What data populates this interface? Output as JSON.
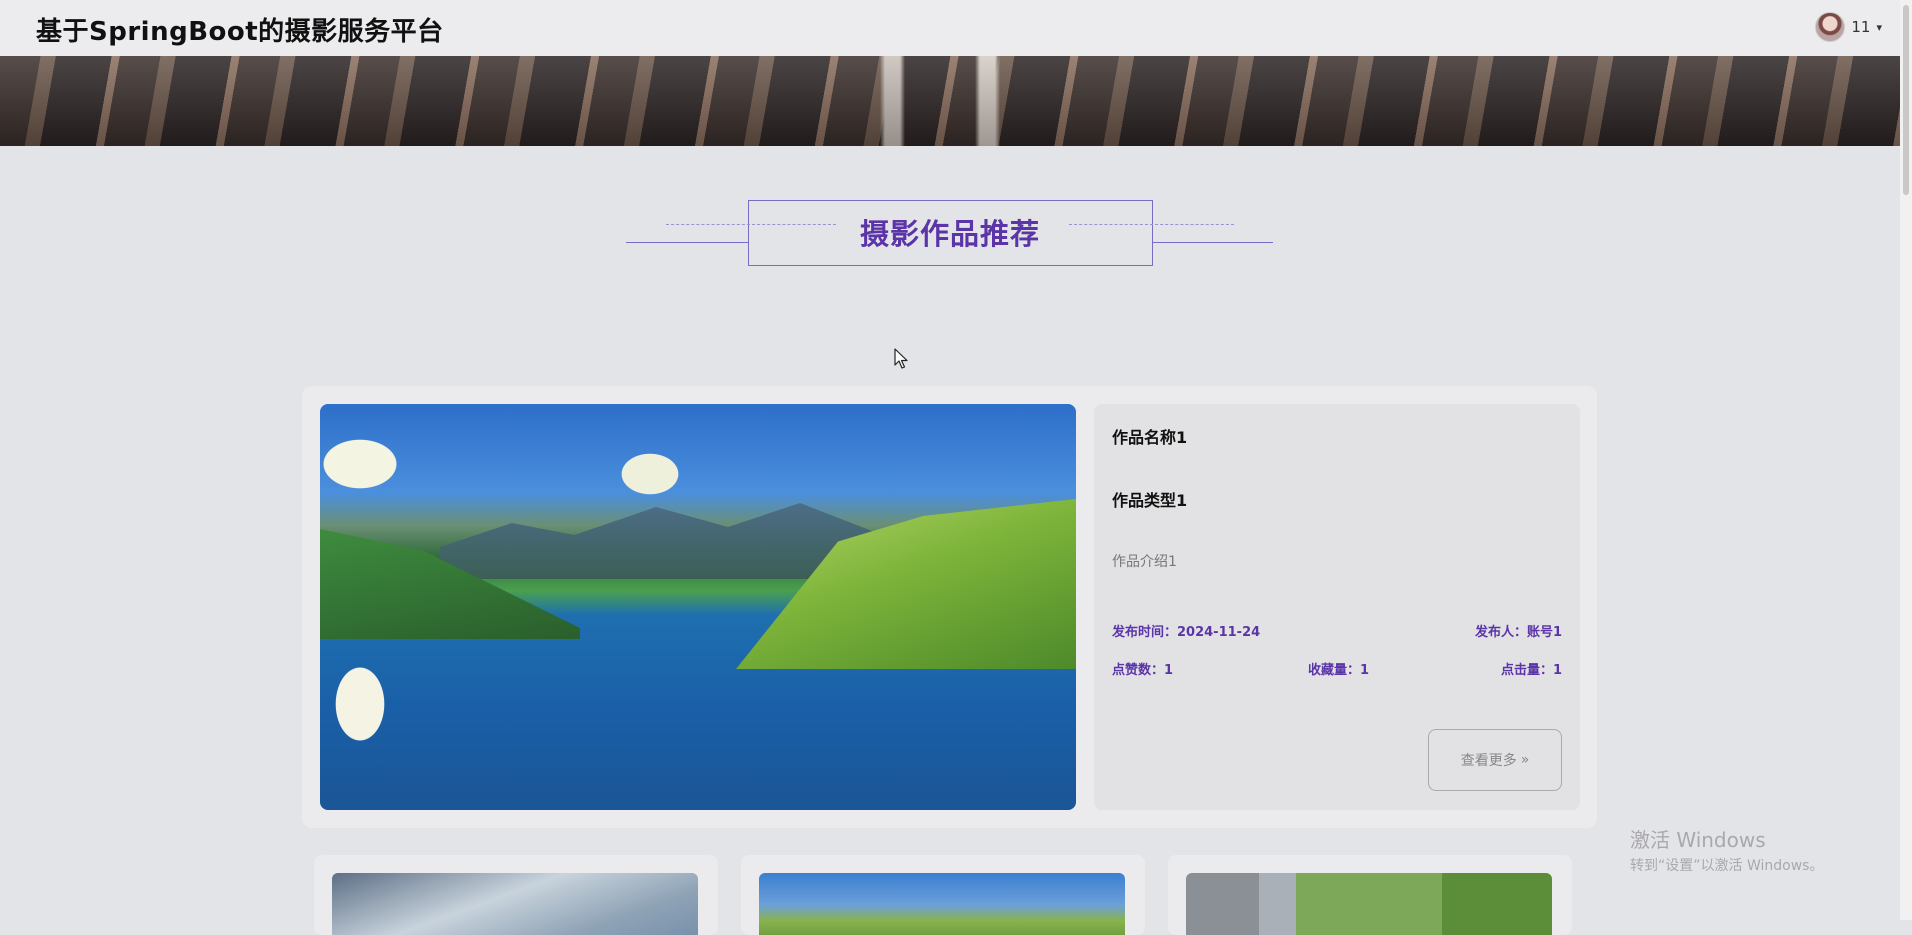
{
  "header": {
    "site_title": "基于SpringBoot的摄影服务平台",
    "username": "11",
    "caret": "▾"
  },
  "section": {
    "title": "摄影作品推荐"
  },
  "featured": {
    "name": "作品名称1",
    "type": "作品类型1",
    "intro": "作品介绍1",
    "publish_time": "发布时间：2024-11-24",
    "publisher": "发布人：账号1",
    "likes": "点赞数：1",
    "favorites": "收藏量：1",
    "clicks": "点击量：1",
    "more_label": "查看更多",
    "more_arrow": "»"
  },
  "watermark": {
    "title": "激活 Windows",
    "subtitle": "转到“设置”以激活 Windows。"
  },
  "icons": {
    "avatar": "user-avatar",
    "caret": "caret-down-icon",
    "cursor": "mouse-cursor-icon",
    "more_arrow": "double-chevron-right-icon"
  },
  "colors": {
    "accent": "#5b35a8",
    "frame": "#7a6cc6",
    "background": "#e3e4e8"
  }
}
